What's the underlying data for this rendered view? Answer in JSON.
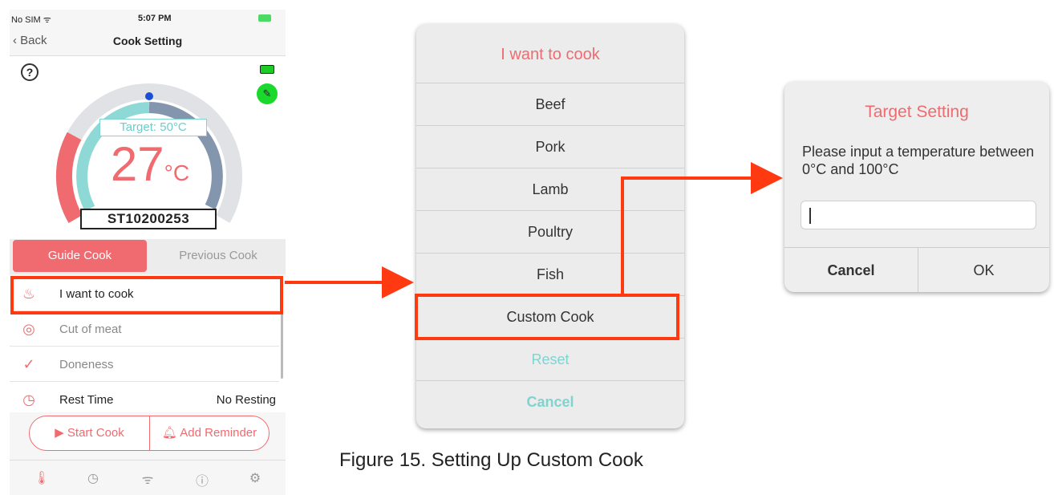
{
  "phone": {
    "status": {
      "carrier": "No SIM ᯤ",
      "time": "5:07 PM"
    },
    "nav": {
      "back_label": "Back",
      "title": "Cook Setting"
    },
    "help_icon": "?",
    "gauge": {
      "target_label": "Target: 50°C",
      "temp_value": "27",
      "temp_unit": "°C",
      "device_id": "ST10200253",
      "current_fraction": 0.5,
      "target_fraction": 0.5
    },
    "tabs": {
      "guide": "Guide Cook",
      "previous": "Previous Cook"
    },
    "list": [
      {
        "icon": "chef-hat-icon",
        "label": "I want to cook",
        "value": ""
      },
      {
        "icon": "steak-icon",
        "label": "Cut of meat",
        "value": ""
      },
      {
        "icon": "check-icon",
        "label": "Doneness",
        "value": ""
      },
      {
        "icon": "clock-icon",
        "label": "Rest Time",
        "value": "No Resting"
      }
    ],
    "actions": {
      "start": "Start Cook",
      "reminder": "Add Reminder"
    },
    "tabbar": [
      "thermometer-icon",
      "clock-icon",
      "wifi-icon",
      "info-icon",
      "settings-icon"
    ]
  },
  "sheet": {
    "title": "I want to cook",
    "options": [
      "Beef",
      "Pork",
      "Lamb",
      "Poultry",
      "Fish",
      "Custom Cook"
    ],
    "reset": "Reset",
    "cancel": "Cancel"
  },
  "dialog": {
    "title": "Target Setting",
    "message": "Please input a temperature between 0°C and 100°C",
    "input_value": "",
    "cancel": "Cancel",
    "ok": "OK"
  },
  "caption": "Figure 15. Setting Up Custom Cook",
  "colors": {
    "accent": "#ef6b70",
    "teal": "#7dd4d0",
    "highlight": "#ff3a10"
  }
}
